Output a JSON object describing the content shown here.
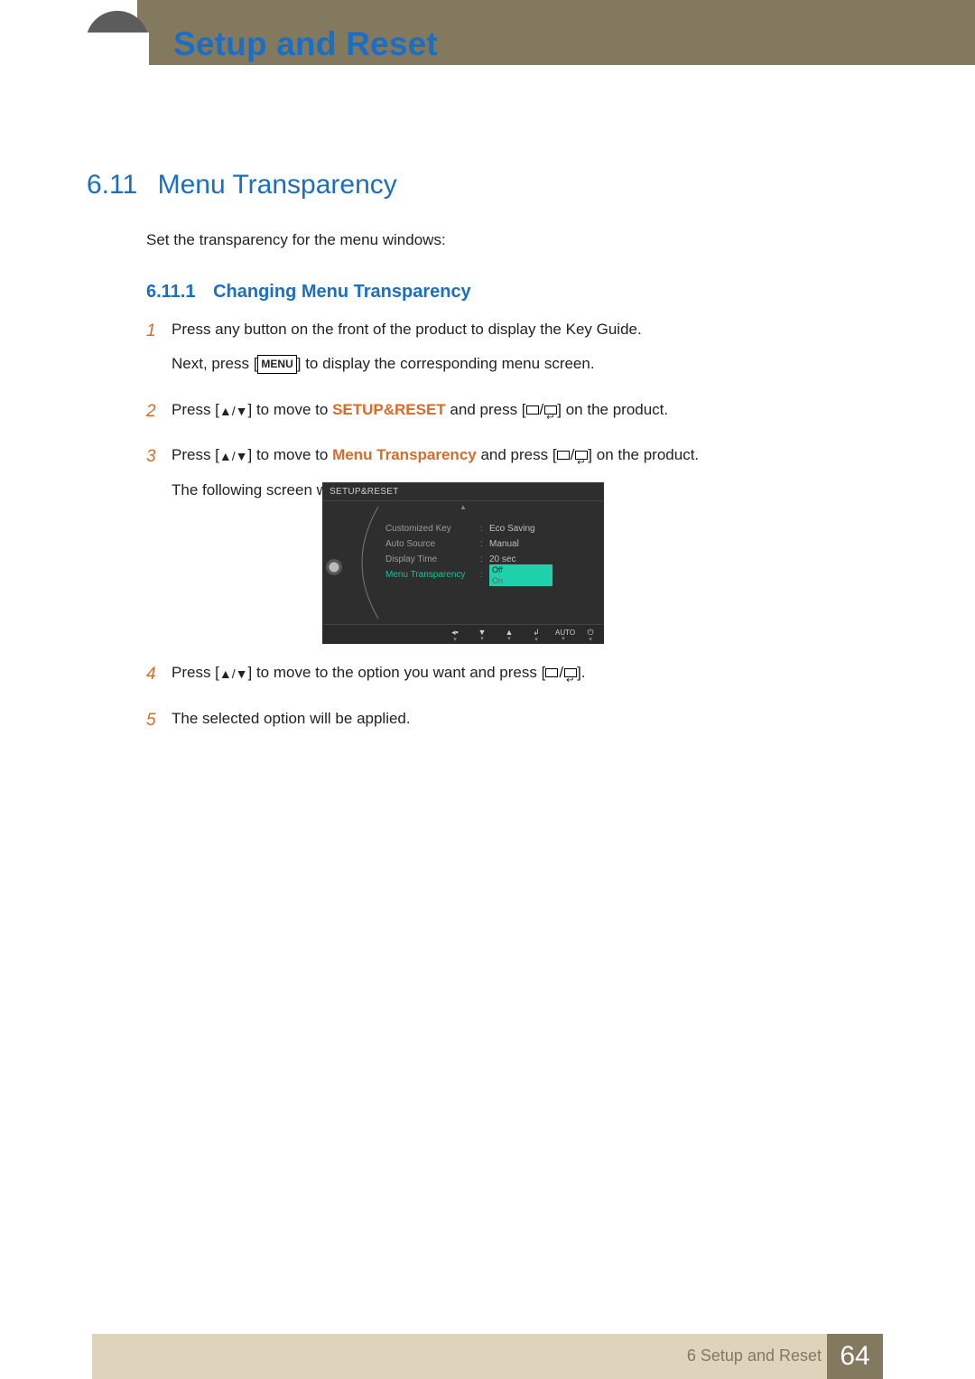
{
  "header": {
    "chapter_title": "Setup and Reset"
  },
  "section": {
    "number": "6.11",
    "title": "Menu Transparency",
    "intro": "Set the transparency for the menu windows:"
  },
  "subsection": {
    "number": "6.11.1",
    "title": "Changing Menu Transparency"
  },
  "steps": {
    "s1": {
      "num": "1",
      "p1": "Press any button on the front of the product to display the Key Guide.",
      "p2a": "Next, press [",
      "menu_key": "MENU",
      "p2b": "] to display the corresponding menu screen."
    },
    "s2": {
      "num": "2",
      "a": "Press [",
      "b": "] to move to ",
      "hl": "SETUP&RESET",
      "c": " and press [",
      "d": "] on the product."
    },
    "s3": {
      "num": "3",
      "a": "Press [",
      "b": "] to move to ",
      "hl": "Menu Transparency",
      "c": " and press [",
      "d": "] on the product.",
      "p2": "The following screen will appear."
    },
    "s4": {
      "num": "4",
      "a": "Press [",
      "b": "] to move to the option you want and press [",
      "c": "]."
    },
    "s5": {
      "num": "5",
      "text": "The selected option will be applied."
    }
  },
  "osd": {
    "title": "SETUP&RESET",
    "rows": [
      {
        "label": "Customized Key",
        "value": "Eco Saving"
      },
      {
        "label": "Auto Source",
        "value": "Manual"
      },
      {
        "label": "Display Time",
        "value": "20 sec"
      }
    ],
    "selected_label": "Menu Transparency",
    "selected_opt1": "Off",
    "selected_opt2": "On",
    "bottom_auto": "AUTO"
  },
  "footer": {
    "chapter": "6 Setup and Reset",
    "page": "64"
  }
}
